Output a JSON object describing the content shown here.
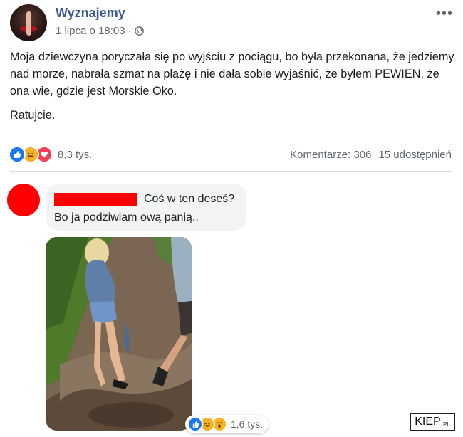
{
  "post": {
    "page_name": "Wyznajemy",
    "timestamp": "1 lipca o 18:03",
    "separator": "·",
    "privacy_icon": "globe-icon",
    "more_icon": "•••",
    "text_paragraph1": "Moja dziewczyna poryczała się po wyjściu z pociągu, bo była przekonana, że jedziemy nad morze, nabrała szmat na plażę i nie dała sobie wyjaśnić, że byłem PEWIEN, że ona wie, gdzie jest Morskie Oko.",
    "text_paragraph2": "Ratujcie.",
    "reaction_icons": [
      "like-icon",
      "haha-icon",
      "love-icon"
    ],
    "reaction_count": "8,3 tys.",
    "comments_count": "Komentarze: 306",
    "shares_count": "15 udostępnień"
  },
  "comment": {
    "text_line1": "Coś w ten deseś?",
    "text_line2": "Bo ja podziwiam ową panią..",
    "reaction_icons": [
      "like-icon",
      "haha-icon",
      "wow-icon"
    ],
    "reaction_count": "1,6 tys."
  },
  "watermark": {
    "text": "KIEP",
    "suffix": ".PL"
  },
  "colors": {
    "link": "#385898",
    "secondary_text": "#606770",
    "like": "#1877f2",
    "love": "#f33e58",
    "haha": "#f7b125",
    "redaction": "#ff0000"
  }
}
